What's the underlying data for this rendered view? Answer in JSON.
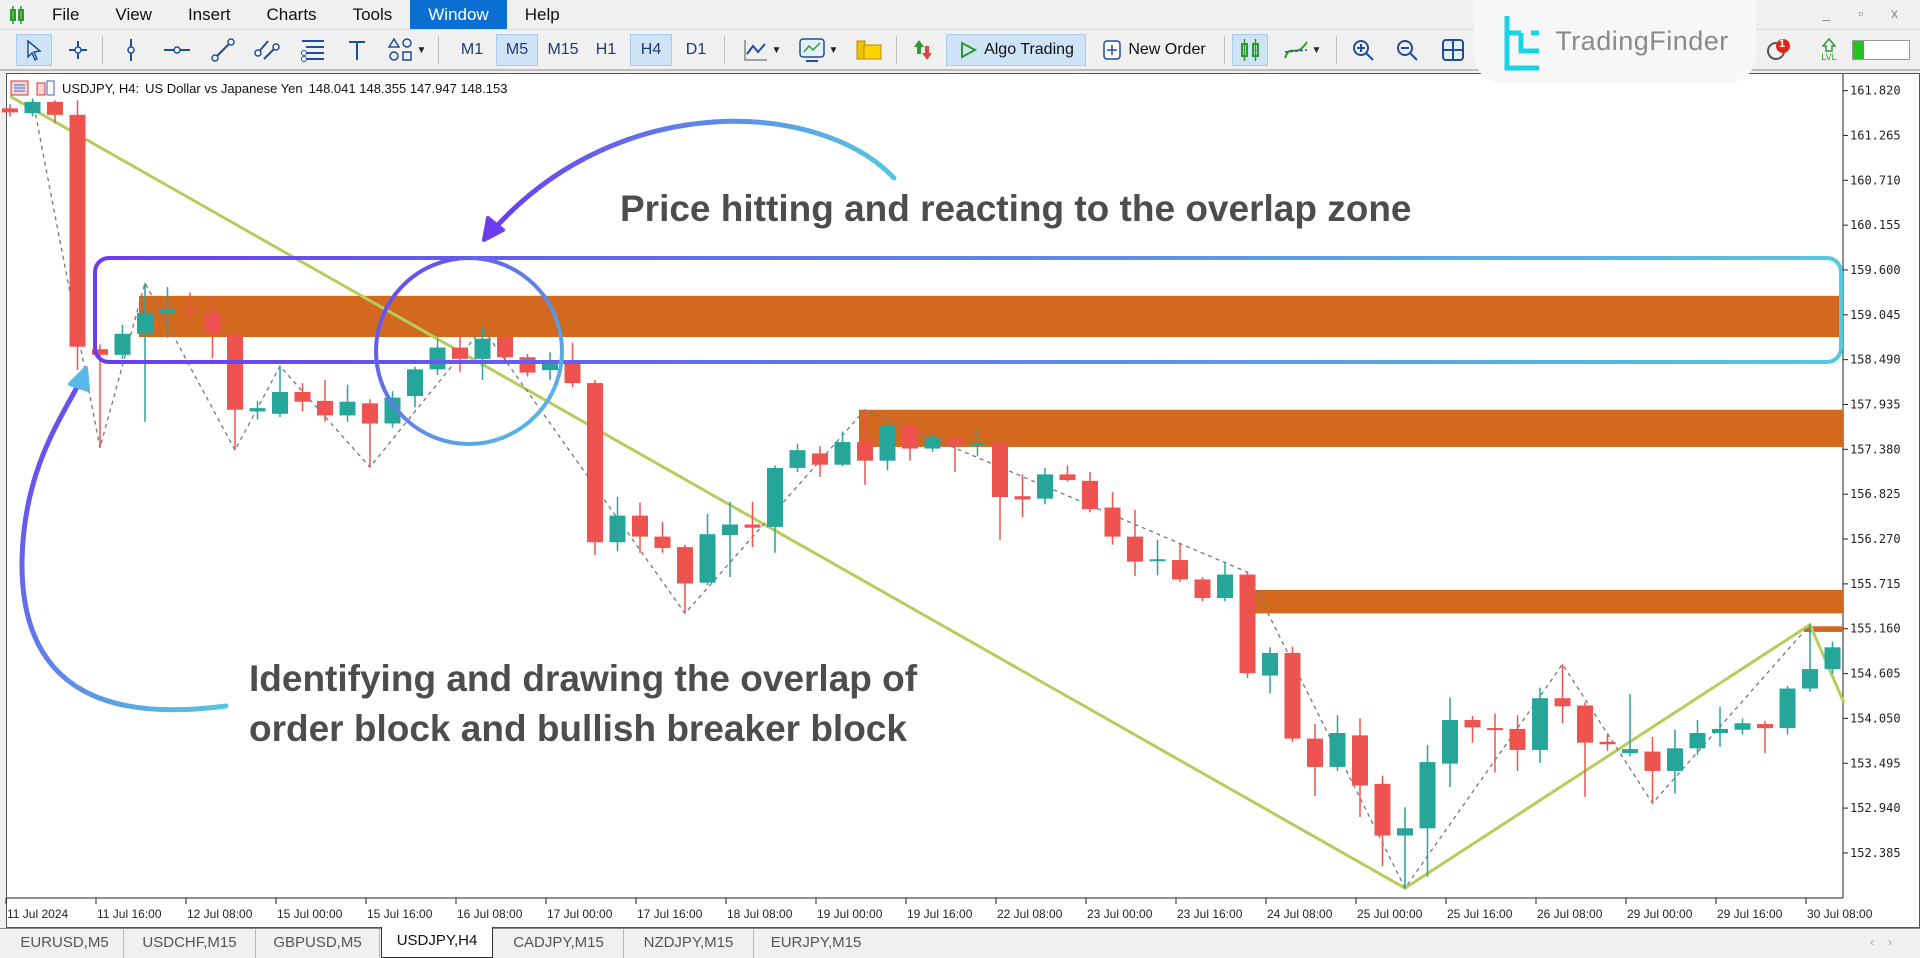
{
  "menu": {
    "items": [
      "File",
      "View",
      "Insert",
      "Charts",
      "Tools",
      "Window",
      "Help"
    ],
    "active": "Window"
  },
  "toolbar": {
    "timeframes": [
      "M1",
      "M5",
      "M15",
      "H1",
      "H4",
      "D1"
    ],
    "selected_timeframes": [
      "M5",
      "H4"
    ],
    "algo_trading_label": "Algo Trading",
    "new_order_label": "New Order",
    "alert_badge": "1",
    "level_label": "LVL",
    "level_progress": 0.2
  },
  "logo": {
    "text": "TradingFinder"
  },
  "chart_header": {
    "symbol": "USDJPY, H4:",
    "description": "US Dollar vs Japanese Yen",
    "ohlc": "148.041 148.355 147.947 148.153"
  },
  "annotations": {
    "top": "Price hitting and reacting to the overlap zone",
    "bottom_line1": "Identifying and drawing the overlap of",
    "bottom_line2": "order block and bullish breaker block"
  },
  "colors": {
    "bull": "#26a69a",
    "bear": "#ef5350",
    "zone": "#d2691e",
    "trendline": "#b8cc5e",
    "accent": "#0a6fd1"
  },
  "chart_data": {
    "type": "candlestick",
    "price_ticks": [
      "161.820",
      "161.265",
      "160.710",
      "160.155",
      "159.600",
      "159.045",
      "158.490",
      "157.935",
      "157.380",
      "156.825",
      "156.270",
      "155.715",
      "155.160",
      "154.605",
      "154.050",
      "153.495",
      "152.940",
      "152.385"
    ],
    "time_ticks": [
      "11 Jul 2024",
      "11 Jul 16:00",
      "12 Jul 08:00",
      "15 Jul 00:00",
      "15 Jul 16:00",
      "16 Jul 08:00",
      "17 Jul 00:00",
      "17 Jul 16:00",
      "18 Jul 08:00",
      "19 Jul 00:00",
      "19 Jul 16:00",
      "22 Jul 08:00",
      "23 Jul 00:00",
      "23 Jul 16:00",
      "24 Jul 08:00",
      "25 Jul 00:00",
      "25 Jul 16:00",
      "26 Jul 08:00",
      "29 Jul 00:00",
      "29 Jul 16:00",
      "30 Jul 08:00"
    ],
    "ohlc": [
      [
        161.6,
        161.65,
        161.5,
        161.55
      ],
      [
        161.54,
        161.72,
        161.5,
        161.68
      ],
      [
        161.68,
        161.7,
        161.42,
        161.52
      ],
      [
        161.52,
        161.7,
        158.36,
        158.65
      ],
      [
        158.62,
        158.68,
        157.4,
        158.55
      ],
      [
        158.55,
        158.92,
        158.5,
        158.81
      ],
      [
        158.81,
        159.44,
        157.72,
        159.07
      ],
      [
        159.07,
        159.39,
        158.76,
        159.12
      ],
      [
        159.12,
        159.32,
        159.0,
        159.1
      ],
      [
        159.07,
        159.25,
        158.51,
        158.82
      ],
      [
        158.8,
        158.85,
        157.37,
        157.87
      ],
      [
        157.85,
        157.98,
        157.75,
        157.89
      ],
      [
        157.82,
        158.41,
        157.78,
        158.09
      ],
      [
        158.09,
        158.2,
        157.85,
        157.97
      ],
      [
        157.98,
        158.24,
        157.72,
        157.8
      ],
      [
        157.8,
        158.18,
        157.72,
        157.97
      ],
      [
        157.95,
        158.0,
        157.16,
        157.7
      ],
      [
        157.7,
        158.1,
        157.65,
        158.02
      ],
      [
        158.04,
        158.4,
        157.9,
        158.37
      ],
      [
        158.37,
        158.75,
        158.3,
        158.64
      ],
      [
        158.64,
        158.8,
        158.34,
        158.5
      ],
      [
        158.5,
        158.88,
        158.24,
        158.75
      ],
      [
        158.77,
        158.82,
        158.45,
        158.52
      ],
      [
        158.52,
        158.56,
        158.28,
        158.33
      ],
      [
        158.36,
        158.58,
        158.24,
        158.45
      ],
      [
        158.48,
        158.7,
        158.15,
        158.2
      ],
      [
        158.2,
        158.24,
        156.07,
        156.23
      ],
      [
        156.23,
        156.79,
        156.12,
        156.56
      ],
      [
        156.56,
        156.72,
        156.1,
        156.3
      ],
      [
        156.3,
        156.48,
        156.1,
        156.16
      ],
      [
        156.17,
        156.2,
        155.35,
        155.72
      ],
      [
        155.73,
        156.58,
        155.7,
        156.33
      ],
      [
        156.32,
        156.73,
        155.8,
        156.45
      ],
      [
        156.45,
        156.73,
        156.17,
        156.41
      ],
      [
        156.42,
        157.18,
        156.1,
        157.15
      ],
      [
        157.15,
        157.45,
        157.1,
        157.37
      ],
      [
        157.33,
        157.42,
        157.04,
        157.19
      ],
      [
        157.19,
        157.6,
        157.17,
        157.47
      ],
      [
        157.47,
        157.85,
        156.94,
        157.24
      ],
      [
        157.24,
        157.75,
        157.12,
        157.67
      ],
      [
        157.67,
        157.7,
        157.24,
        157.39
      ],
      [
        157.39,
        157.58,
        157.35,
        157.52
      ],
      [
        157.5,
        157.55,
        157.1,
        157.42
      ],
      [
        157.44,
        157.62,
        157.3,
        157.46
      ],
      [
        157.45,
        157.48,
        156.26,
        156.79
      ],
      [
        156.8,
        157.07,
        156.54,
        156.76
      ],
      [
        156.77,
        157.15,
        156.7,
        157.07
      ],
      [
        157.07,
        157.18,
        156.98,
        157.0
      ],
      [
        156.99,
        157.1,
        156.6,
        156.64
      ],
      [
        156.66,
        156.85,
        156.2,
        156.3
      ],
      [
        156.3,
        156.63,
        155.81,
        155.99
      ],
      [
        156.0,
        156.26,
        155.82,
        156.02
      ],
      [
        156.01,
        156.21,
        155.74,
        155.77
      ],
      [
        155.77,
        155.8,
        155.5,
        155.54
      ],
      [
        155.54,
        155.99,
        155.5,
        155.83
      ],
      [
        155.83,
        155.86,
        154.55,
        154.61
      ],
      [
        154.58,
        154.93,
        154.36,
        154.86
      ],
      [
        154.86,
        154.94,
        153.76,
        153.8
      ],
      [
        153.8,
        153.98,
        153.09,
        153.45
      ],
      [
        153.45,
        154.09,
        153.4,
        153.87
      ],
      [
        153.84,
        154.05,
        152.83,
        153.22
      ],
      [
        153.24,
        153.34,
        152.22,
        152.6
      ],
      [
        152.6,
        152.95,
        151.95,
        152.69
      ],
      [
        152.69,
        153.72,
        152.09,
        153.51
      ],
      [
        153.49,
        154.31,
        153.2,
        154.03
      ],
      [
        154.03,
        154.08,
        153.75,
        153.94
      ],
      [
        153.93,
        154.11,
        153.38,
        153.91
      ],
      [
        153.92,
        154.09,
        153.4,
        153.66
      ],
      [
        153.66,
        154.43,
        153.5,
        154.3
      ],
      [
        154.3,
        154.72,
        153.99,
        154.2
      ],
      [
        154.21,
        154.25,
        153.08,
        153.75
      ],
      [
        153.76,
        153.85,
        153.65,
        153.73
      ],
      [
        153.62,
        154.35,
        153.58,
        153.67
      ],
      [
        153.64,
        153.82,
        153.0,
        153.4
      ],
      [
        153.4,
        153.91,
        153.12,
        153.68
      ],
      [
        153.68,
        154.03,
        153.6,
        153.87
      ],
      [
        153.87,
        154.19,
        153.7,
        153.92
      ],
      [
        153.91,
        154.05,
        153.85,
        153.99
      ],
      [
        153.98,
        154.02,
        153.62,
        153.93
      ],
      [
        153.93,
        154.45,
        153.85,
        154.42
      ],
      [
        154.42,
        155.21,
        154.38,
        154.66
      ],
      [
        154.66,
        155.0,
        154.6,
        154.93
      ]
    ],
    "zones": [
      {
        "from_bar": 6,
        "top": 159.28,
        "bottom": 158.77
      },
      {
        "from_bar": 38,
        "top": 157.87,
        "bottom": 157.41
      },
      {
        "from_bar": 55,
        "top": 155.64,
        "bottom": 155.35
      },
      {
        "from_bar": 80,
        "top": 155.19,
        "bottom": 155.12
      }
    ],
    "trend_zigzag": [
      [
        0,
        161.75
      ],
      [
        62,
        151.95
      ],
      [
        80,
        155.21
      ],
      [
        81.5,
        154.25
      ]
    ],
    "swing_zigzag": [
      [
        1,
        161.72
      ],
      [
        4,
        157.4
      ],
      [
        6,
        159.44
      ],
      [
        10,
        157.37
      ],
      [
        12,
        158.41
      ],
      [
        16,
        157.16
      ],
      [
        21,
        158.88
      ],
      [
        30,
        155.35
      ],
      [
        38,
        157.87
      ],
      [
        55,
        155.86
      ],
      [
        62,
        151.95
      ],
      [
        69,
        154.72
      ],
      [
        73,
        153.0
      ],
      [
        80,
        155.21
      ]
    ]
  },
  "tabs": {
    "items": [
      "EURUSD,M5",
      "USDCHF,M15",
      "GBPUSD,M5",
      "USDJPY,H4",
      "CADJPY,M15",
      "NZDJPY,M15",
      "EURJPY,M15"
    ],
    "active": "USDJPY,H4"
  }
}
